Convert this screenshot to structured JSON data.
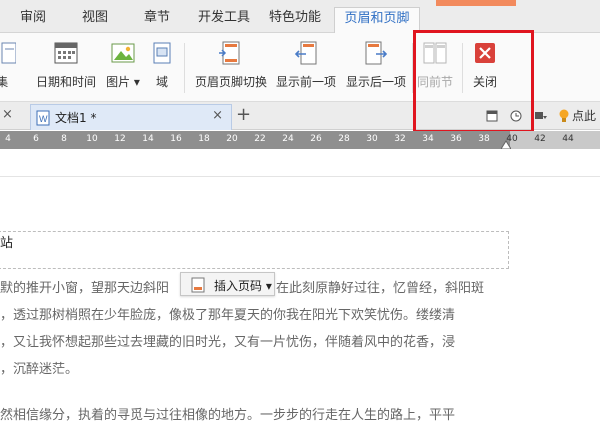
{
  "menu_tabs": [
    "审阅",
    "视图",
    "章节",
    "开发工具",
    "特色功能",
    "页眉和页脚"
  ],
  "ribbon": {
    "partial_label": "文集",
    "date_time": "日期和时间",
    "picture": "图片",
    "domain": "域",
    "switch_header_footer": "页眉页脚切换",
    "show_prev": "显示前一项",
    "show_next": "显示后一项",
    "same_as_prev": "同前节",
    "close": "关闭"
  },
  "doc_tab": {
    "name": "文档1 *",
    "close": "×",
    "add": "+"
  },
  "hint": "点此",
  "ruler_numbers": [
    "4",
    "6",
    "8",
    "10",
    "12",
    "14",
    "16",
    "18",
    "20",
    "22",
    "24",
    "26",
    "28",
    "30",
    "32",
    "34",
    "36",
    "38",
    "40",
    "42",
    "44"
  ],
  "document": {
    "header_text": "站",
    "insert_page_number": "插入页码",
    "lines": [
      "默的推开小窗，望那天边斜阳",
      "在此刻原静好过往，忆曾经，斜阳斑",
      "，透过那树梢照在少年脸庞，像极了那年夏天的你我在阳光下欢笑忧伤。缕缕清",
      "，又让我怀想起那些过去埋藏的旧时光，又有一片忧伤，伴随着风中的花香，浸",
      "，沉醉迷茫。",
      "然相信缘分，执着的寻觅与过往相像的地方。一步步的行走在人生的路上，平平"
    ]
  },
  "colors": {
    "highlight_box": "#e0151f",
    "active_tab_text": "#2f6fc4"
  }
}
